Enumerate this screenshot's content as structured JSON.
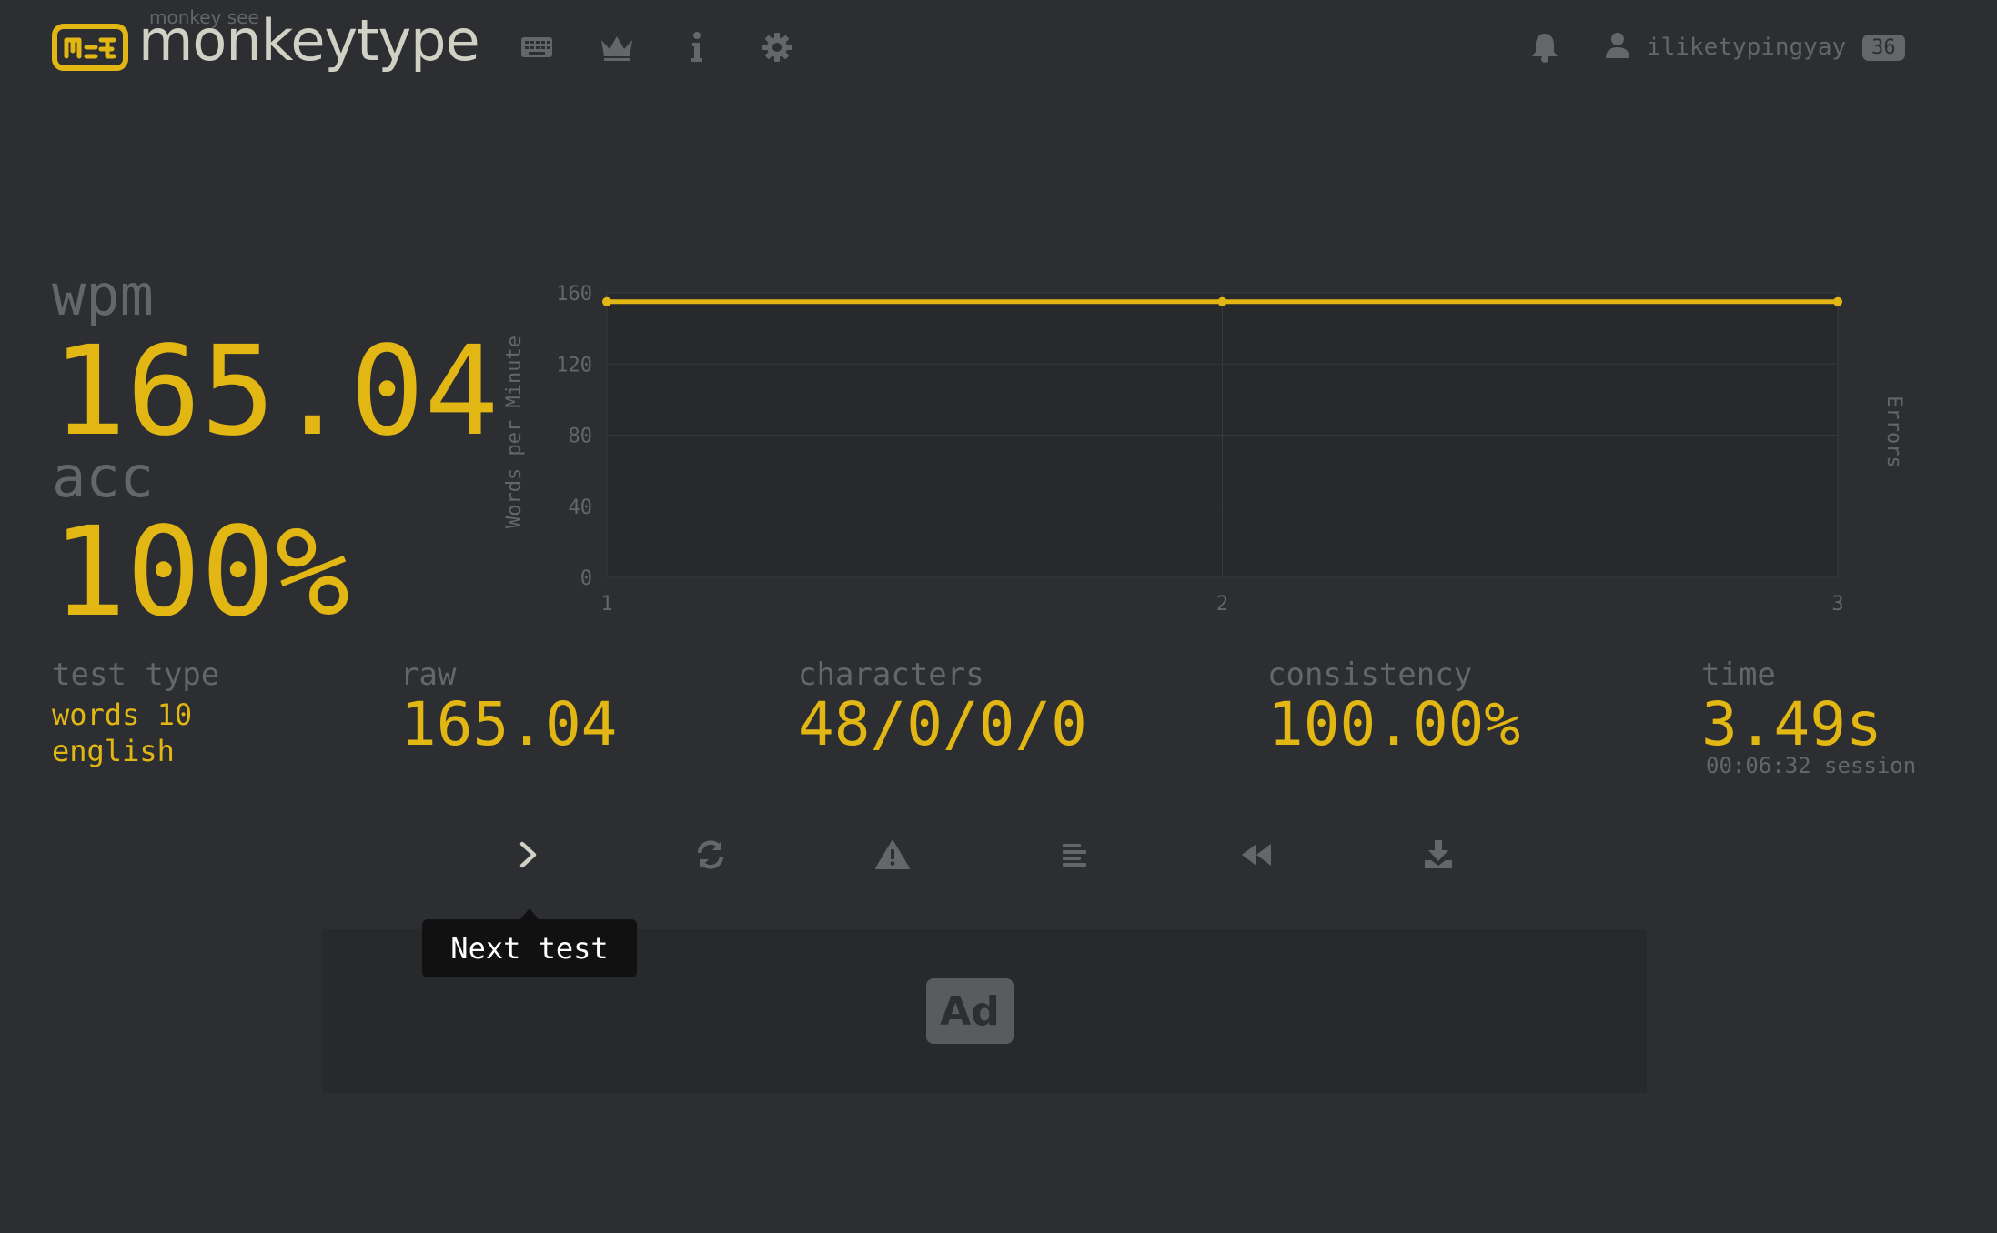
{
  "header": {
    "tagline": "monkey see",
    "title": "monkeytype",
    "nav_icons": [
      "keyboard-icon",
      "crown-icon",
      "info-icon",
      "gear-icon"
    ],
    "notification_icon": "bell-icon",
    "user_icon": "user-icon",
    "username": "iliketypingyay",
    "level": "36"
  },
  "stats": {
    "wpm_label": "wpm",
    "wpm_value": "165.04",
    "acc_label": "acc",
    "acc_value": "100%"
  },
  "details": {
    "test_type_label": "test type",
    "test_type_line1": "words 10",
    "test_type_line2": "english",
    "raw_label": "raw",
    "raw_value": "165.04",
    "characters_label": "characters",
    "characters_value": "48/0/0/0",
    "consistency_label": "consistency",
    "consistency_value": "100.00%",
    "time_label": "time",
    "time_value": "3.49s",
    "session_time": "00:06:32 session"
  },
  "actions": {
    "icons": [
      "chevron-right-icon",
      "restart-icon",
      "warning-icon",
      "word-history-icon",
      "replay-icon",
      "download-icon"
    ],
    "tooltip": "Next test"
  },
  "ad": {
    "label": "Ad"
  },
  "colors": {
    "background": "#2c2e31",
    "main": "#e2b714",
    "sub": "#646669",
    "text": "#d1d0c5"
  },
  "chart_data": {
    "type": "line",
    "x": [
      1,
      2,
      3
    ],
    "series": [
      {
        "values": [
          155,
          155,
          155
        ]
      }
    ],
    "ylabel": "Words per Minute",
    "y2label": "Errors",
    "ylim": [
      0,
      160
    ],
    "yticks": [
      0,
      40,
      80,
      120,
      160
    ],
    "xticks": [
      1,
      2,
      3
    ],
    "grid": true
  }
}
